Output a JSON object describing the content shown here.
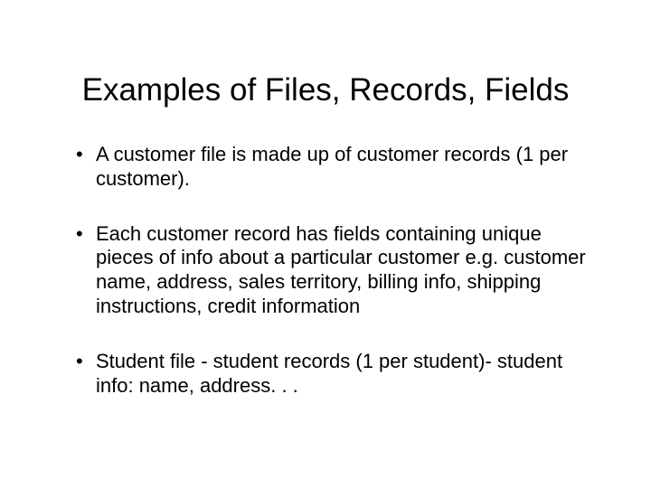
{
  "title": "Examples of Files, Records, Fields",
  "bullets": [
    "A customer file is made up of customer records (1 per customer).",
    "Each customer record has fields containing unique pieces of info about a particular customer e.g. customer name, address, sales territory, billing info, shipping instructions,\ncredit information",
    "Student file - student records (1 per student)- student info: name, address. . ."
  ]
}
